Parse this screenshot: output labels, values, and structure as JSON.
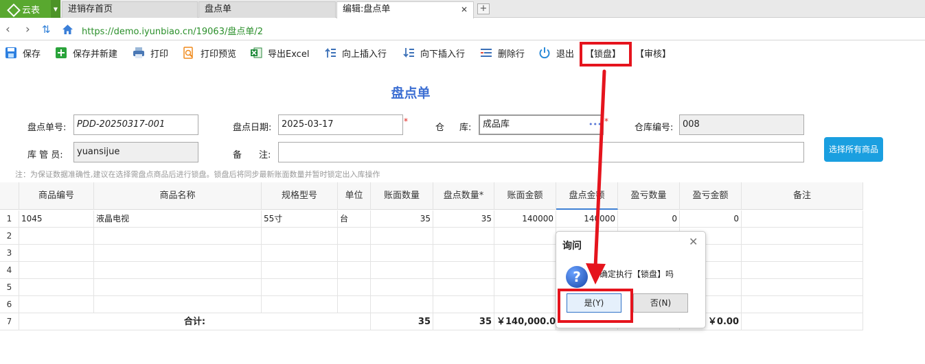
{
  "app": {
    "name": "云表"
  },
  "tabs": [
    {
      "label": "进销存首页"
    },
    {
      "label": "盘点单"
    },
    {
      "label": "编辑:盘点单",
      "close": "✕"
    }
  ],
  "address": {
    "url": "https://demo.iyunbiao.cn/19063/盘点单/2"
  },
  "toolbar": {
    "save": "保存",
    "save_new": "保存并新建",
    "print": "打印",
    "print_preview": "打印预览",
    "export_excel": "导出Excel",
    "insert_up": "向上插入行",
    "insert_down": "向下插入行",
    "delete_row": "删除行",
    "exit": "退出",
    "lock": "【锁盘】",
    "audit": "【审核】"
  },
  "form": {
    "title": "盘点单",
    "doc_no_label": "盘点单号:",
    "doc_no": "PDD-20250317-001",
    "date_label": "盘点日期:",
    "date": "2025-03-17",
    "warehouse_label_1": "仓",
    "warehouse_label_2": "库:",
    "warehouse": "成品库",
    "warehouse_dots": "•••",
    "warehouse_code_label": "仓库编号:",
    "warehouse_code": "008",
    "keeper_label": "库 管 员:",
    "keeper": "yuansijue",
    "remark_label_1": "备",
    "remark_label_2": "注:",
    "remark": "",
    "required_mark": "*",
    "select_all_button": "选择所有商品",
    "note": "注：为保证数据准确性,建议在选择需盘点商品后进行锁盘。锁盘后将同步最新账面数量并暂时锁定出入库操作"
  },
  "grid": {
    "headers": [
      "商品编号",
      "商品名称",
      "规格型号",
      "单位",
      "账面数量",
      "盘点数量*",
      "账面金额",
      "盘点金额",
      "盈亏数量",
      "盈亏金额",
      "备注"
    ],
    "row_numbers": [
      "1",
      "2",
      "3",
      "4",
      "5",
      "6",
      "7"
    ],
    "rows": [
      {
        "code": "1045",
        "name": "液晶电视",
        "spec": "55寸",
        "unit": "台",
        "book_qty": "35",
        "count_qty": "35",
        "book_amt": "140000",
        "count_amt": "140000",
        "diff_qty": "0",
        "diff_amt": "0",
        "remark": ""
      }
    ],
    "total": {
      "label": "合计:",
      "book_qty": "35",
      "count_qty": "35",
      "book_amt": "￥140,000.00",
      "diff_amt": "￥0.00"
    }
  },
  "dialog": {
    "title": "询问",
    "close": "✕",
    "icon": "question-icon",
    "message": "确定执行【锁盘】吗",
    "yes": "是(Y)",
    "no": "否(N)"
  },
  "colors": {
    "app_green": "#59a82f",
    "accent_blue": "#3d6fd3",
    "button_blue": "#1a9fe0",
    "highlight_red": "#e5141d",
    "required_red": "#e0201a"
  }
}
